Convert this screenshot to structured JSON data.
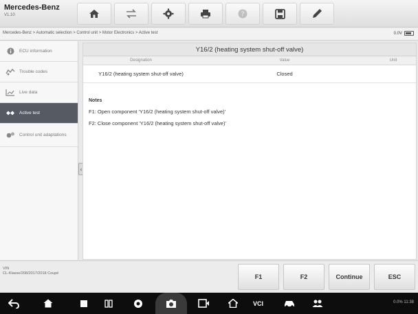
{
  "header": {
    "brand": "Mercedes-Benz",
    "brand_sub": "V1.10",
    "toolbar": [
      {
        "icon": "home-icon"
      },
      {
        "icon": "vehicle-swap-icon"
      },
      {
        "icon": "settings-icon"
      },
      {
        "icon": "print-icon"
      },
      {
        "icon": "help-icon",
        "disabled": true
      },
      {
        "icon": "save-icon"
      },
      {
        "icon": "edit-icon"
      }
    ]
  },
  "breadcrumb": "Mercedes-Benz > Automatic selection > Control unit > Motor Electronics > Active test",
  "battery": {
    "voltage": "0.0V"
  },
  "sidebar": {
    "items": [
      {
        "label": "ECU information",
        "icon": "ecu-info-icon",
        "active": false
      },
      {
        "label": "Trouble codes",
        "icon": "trouble-codes-icon",
        "active": false
      },
      {
        "label": "Live data",
        "icon": "live-data-icon",
        "active": false
      },
      {
        "label": "Active test",
        "icon": "active-test-icon",
        "active": true
      },
      {
        "label": "Control unit adaptations",
        "icon": "adaptations-icon",
        "active": false
      }
    ]
  },
  "main": {
    "title": "Y16/2 (heating system shut-off valve)",
    "columns": [
      "Designation",
      "Value",
      "Unit"
    ],
    "rows": [
      {
        "designation": "Y16/2 (heating system shut-off valve)",
        "value": "Closed",
        "unit": ""
      }
    ],
    "notes_title": "Notes",
    "notes": [
      "F1: Open component 'Y16/2 (heating system shut-off valve)'",
      "F2: Close component 'Y16/2 (heating system shut-off valve)'"
    ]
  },
  "bottom": {
    "vehicle_line1": "VIN",
    "vehicle_line2": "CL-Klasse/208/2017/2018 Coupé",
    "fkeys": [
      "F1",
      "F2",
      "Continue",
      "ESC"
    ]
  },
  "navbar": {
    "vci_label": "VCI",
    "status": "0.0% 11:38"
  }
}
